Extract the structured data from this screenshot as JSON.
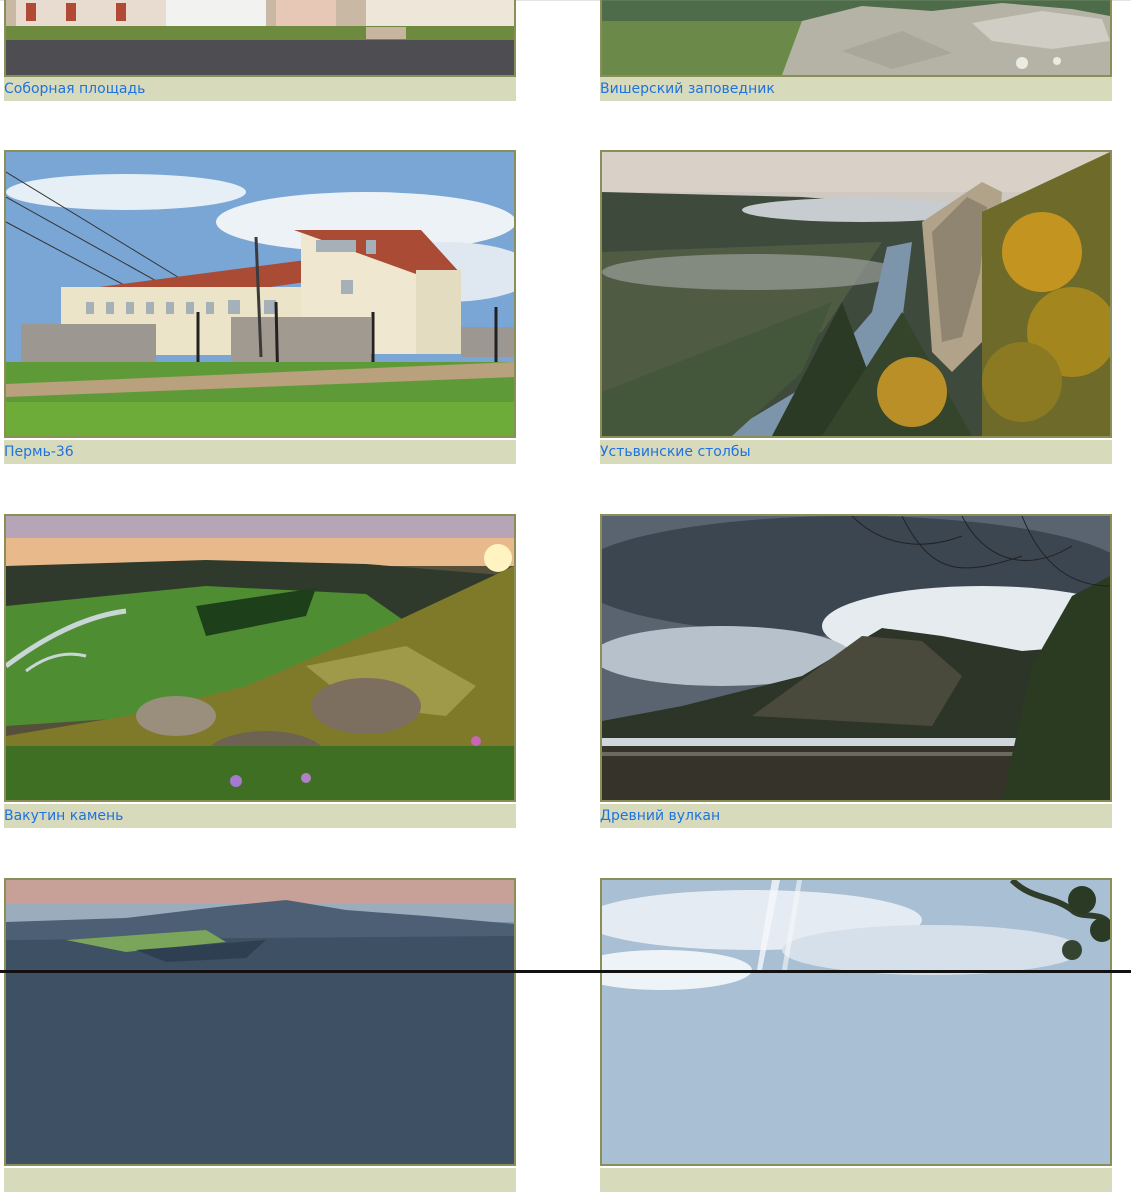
{
  "gallery": {
    "items": [
      {
        "caption": "Соборная площадь",
        "image": "town-square-photo"
      },
      {
        "caption": "Вишерский заповедник",
        "image": "rocky-reserve-photo"
      },
      {
        "caption": "Пермь-36",
        "image": "prison-camp-photo"
      },
      {
        "caption": "Устьвинские столбы",
        "image": "river-cliff-photo"
      },
      {
        "caption": "Вакутин камень",
        "image": "sunset-hill-photo"
      },
      {
        "caption": "Древний вулкан",
        "image": "cloudy-river-photo"
      },
      {
        "caption": "",
        "image": "distant-mountain-photo"
      },
      {
        "caption": "",
        "image": "cloudy-sky-photo"
      }
    ]
  },
  "colors": {
    "caption_bg": "#d8dabc",
    "caption_text": "#1e73e0",
    "frame": "#8a8f5a"
  }
}
